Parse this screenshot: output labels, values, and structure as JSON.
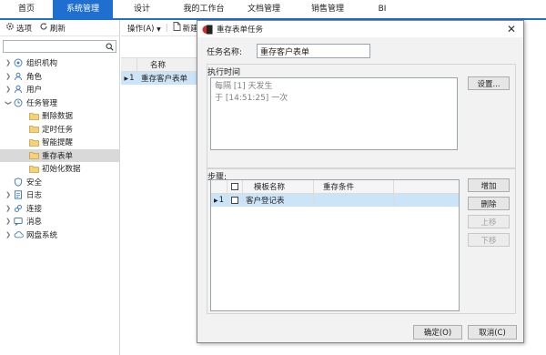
{
  "topnav": {
    "tabs": [
      {
        "label": "首页"
      },
      {
        "label": "系统管理"
      },
      {
        "label": "设计"
      },
      {
        "label": "我的工作台"
      },
      {
        "label": "文档管理"
      },
      {
        "label": "销售管理"
      },
      {
        "label": "BI"
      }
    ]
  },
  "left": {
    "toolbar": {
      "options_label": "选项",
      "refresh_label": "刷新"
    },
    "search": {
      "value": "",
      "placeholder": ""
    },
    "tree": [
      {
        "label": "组织机构",
        "icon": "org-icon"
      },
      {
        "label": "角色",
        "icon": "role-icon"
      },
      {
        "label": "用户",
        "icon": "user-icon"
      },
      {
        "label": "任务管理",
        "icon": "clock-icon"
      },
      {
        "label": "删除数据",
        "icon": "folder-icon"
      },
      {
        "label": "定时任务",
        "icon": "folder-icon"
      },
      {
        "label": "智能提醒",
        "icon": "folder-icon"
      },
      {
        "label": "重存表单",
        "icon": "folder-icon"
      },
      {
        "label": "初始化数据",
        "icon": "folder-icon"
      },
      {
        "label": "安全",
        "icon": "shield-icon"
      },
      {
        "label": "日志",
        "icon": "log-icon"
      },
      {
        "label": "连接",
        "icon": "link-icon"
      },
      {
        "label": "消息",
        "icon": "message-icon"
      },
      {
        "label": "网盘系统",
        "icon": "cloud-icon"
      }
    ]
  },
  "middle": {
    "toolbar": {
      "actions_label": "操作(A)",
      "new_label": "新建"
    },
    "grid": {
      "header_name": "名称",
      "row_indicator": "1",
      "row_name": "重存客户表单"
    }
  },
  "dialog": {
    "title": "重存表单任务",
    "task_name_label": "任务名称:",
    "task_name_value": "重存客户表单",
    "exec_time_label": "执行时间",
    "schedule_line1": "每隔 [1] 天发生",
    "schedule_line2": "于 [14:51:25] 一次",
    "settings_button": "设置...",
    "steps_label": "步骤:",
    "steps_grid": {
      "col_template": "模板名称",
      "col_condition": "重存条件",
      "rows": [
        {
          "index": "1",
          "template": "客户登记表",
          "condition": ""
        }
      ]
    },
    "add_button": "增加",
    "delete_button": "删除",
    "move_up_button": "上移",
    "move_down_button": "下移",
    "ok_button": "确定(O)",
    "cancel_button": "取消(C)"
  },
  "colors": {
    "accent": "#1e6fd0",
    "selected_row": "#cce4f7"
  }
}
